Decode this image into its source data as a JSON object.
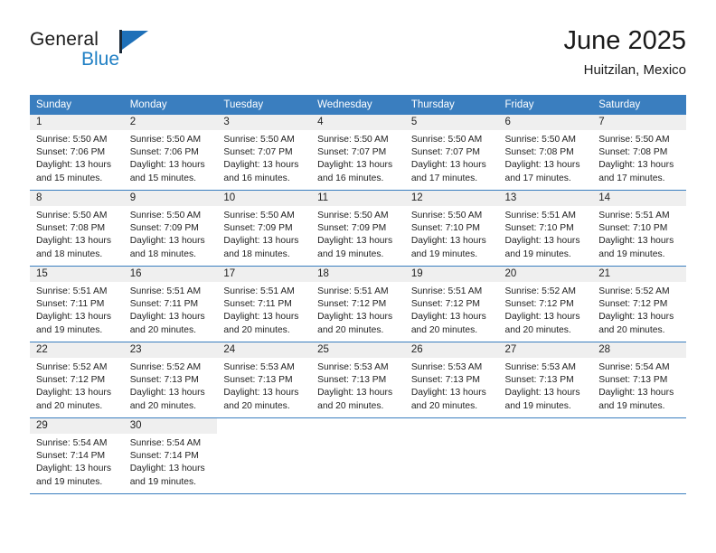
{
  "brand": {
    "name_part1": "General",
    "name_part2": "Blue",
    "flag_icon": "flag-icon",
    "accent_color": "#1e70b8"
  },
  "header": {
    "title": "June 2025",
    "location": "Huitzilan, Mexico"
  },
  "theme": {
    "header_blue": "#3a7ebf",
    "daynum_bg": "#efefef",
    "text": "#222222"
  },
  "columns": [
    "Sunday",
    "Monday",
    "Tuesday",
    "Wednesday",
    "Thursday",
    "Friday",
    "Saturday"
  ],
  "weeks": [
    [
      {
        "day": "1",
        "sunrise": "Sunrise: 5:50 AM",
        "sunset": "Sunset: 7:06 PM",
        "daylight1": "Daylight: 13 hours",
        "daylight2": "and 15 minutes."
      },
      {
        "day": "2",
        "sunrise": "Sunrise: 5:50 AM",
        "sunset": "Sunset: 7:06 PM",
        "daylight1": "Daylight: 13 hours",
        "daylight2": "and 15 minutes."
      },
      {
        "day": "3",
        "sunrise": "Sunrise: 5:50 AM",
        "sunset": "Sunset: 7:07 PM",
        "daylight1": "Daylight: 13 hours",
        "daylight2": "and 16 minutes."
      },
      {
        "day": "4",
        "sunrise": "Sunrise: 5:50 AM",
        "sunset": "Sunset: 7:07 PM",
        "daylight1": "Daylight: 13 hours",
        "daylight2": "and 16 minutes."
      },
      {
        "day": "5",
        "sunrise": "Sunrise: 5:50 AM",
        "sunset": "Sunset: 7:07 PM",
        "daylight1": "Daylight: 13 hours",
        "daylight2": "and 17 minutes."
      },
      {
        "day": "6",
        "sunrise": "Sunrise: 5:50 AM",
        "sunset": "Sunset: 7:08 PM",
        "daylight1": "Daylight: 13 hours",
        "daylight2": "and 17 minutes."
      },
      {
        "day": "7",
        "sunrise": "Sunrise: 5:50 AM",
        "sunset": "Sunset: 7:08 PM",
        "daylight1": "Daylight: 13 hours",
        "daylight2": "and 17 minutes."
      }
    ],
    [
      {
        "day": "8",
        "sunrise": "Sunrise: 5:50 AM",
        "sunset": "Sunset: 7:08 PM",
        "daylight1": "Daylight: 13 hours",
        "daylight2": "and 18 minutes."
      },
      {
        "day": "9",
        "sunrise": "Sunrise: 5:50 AM",
        "sunset": "Sunset: 7:09 PM",
        "daylight1": "Daylight: 13 hours",
        "daylight2": "and 18 minutes."
      },
      {
        "day": "10",
        "sunrise": "Sunrise: 5:50 AM",
        "sunset": "Sunset: 7:09 PM",
        "daylight1": "Daylight: 13 hours",
        "daylight2": "and 18 minutes."
      },
      {
        "day": "11",
        "sunrise": "Sunrise: 5:50 AM",
        "sunset": "Sunset: 7:09 PM",
        "daylight1": "Daylight: 13 hours",
        "daylight2": "and 19 minutes."
      },
      {
        "day": "12",
        "sunrise": "Sunrise: 5:50 AM",
        "sunset": "Sunset: 7:10 PM",
        "daylight1": "Daylight: 13 hours",
        "daylight2": "and 19 minutes."
      },
      {
        "day": "13",
        "sunrise": "Sunrise: 5:51 AM",
        "sunset": "Sunset: 7:10 PM",
        "daylight1": "Daylight: 13 hours",
        "daylight2": "and 19 minutes."
      },
      {
        "day": "14",
        "sunrise": "Sunrise: 5:51 AM",
        "sunset": "Sunset: 7:10 PM",
        "daylight1": "Daylight: 13 hours",
        "daylight2": "and 19 minutes."
      }
    ],
    [
      {
        "day": "15",
        "sunrise": "Sunrise: 5:51 AM",
        "sunset": "Sunset: 7:11 PM",
        "daylight1": "Daylight: 13 hours",
        "daylight2": "and 19 minutes."
      },
      {
        "day": "16",
        "sunrise": "Sunrise: 5:51 AM",
        "sunset": "Sunset: 7:11 PM",
        "daylight1": "Daylight: 13 hours",
        "daylight2": "and 20 minutes."
      },
      {
        "day": "17",
        "sunrise": "Sunrise: 5:51 AM",
        "sunset": "Sunset: 7:11 PM",
        "daylight1": "Daylight: 13 hours",
        "daylight2": "and 20 minutes."
      },
      {
        "day": "18",
        "sunrise": "Sunrise: 5:51 AM",
        "sunset": "Sunset: 7:12 PM",
        "daylight1": "Daylight: 13 hours",
        "daylight2": "and 20 minutes."
      },
      {
        "day": "19",
        "sunrise": "Sunrise: 5:51 AM",
        "sunset": "Sunset: 7:12 PM",
        "daylight1": "Daylight: 13 hours",
        "daylight2": "and 20 minutes."
      },
      {
        "day": "20",
        "sunrise": "Sunrise: 5:52 AM",
        "sunset": "Sunset: 7:12 PM",
        "daylight1": "Daylight: 13 hours",
        "daylight2": "and 20 minutes."
      },
      {
        "day": "21",
        "sunrise": "Sunrise: 5:52 AM",
        "sunset": "Sunset: 7:12 PM",
        "daylight1": "Daylight: 13 hours",
        "daylight2": "and 20 minutes."
      }
    ],
    [
      {
        "day": "22",
        "sunrise": "Sunrise: 5:52 AM",
        "sunset": "Sunset: 7:12 PM",
        "daylight1": "Daylight: 13 hours",
        "daylight2": "and 20 minutes."
      },
      {
        "day": "23",
        "sunrise": "Sunrise: 5:52 AM",
        "sunset": "Sunset: 7:13 PM",
        "daylight1": "Daylight: 13 hours",
        "daylight2": "and 20 minutes."
      },
      {
        "day": "24",
        "sunrise": "Sunrise: 5:53 AM",
        "sunset": "Sunset: 7:13 PM",
        "daylight1": "Daylight: 13 hours",
        "daylight2": "and 20 minutes."
      },
      {
        "day": "25",
        "sunrise": "Sunrise: 5:53 AM",
        "sunset": "Sunset: 7:13 PM",
        "daylight1": "Daylight: 13 hours",
        "daylight2": "and 20 minutes."
      },
      {
        "day": "26",
        "sunrise": "Sunrise: 5:53 AM",
        "sunset": "Sunset: 7:13 PM",
        "daylight1": "Daylight: 13 hours",
        "daylight2": "and 20 minutes."
      },
      {
        "day": "27",
        "sunrise": "Sunrise: 5:53 AM",
        "sunset": "Sunset: 7:13 PM",
        "daylight1": "Daylight: 13 hours",
        "daylight2": "and 19 minutes."
      },
      {
        "day": "28",
        "sunrise": "Sunrise: 5:54 AM",
        "sunset": "Sunset: 7:13 PM",
        "daylight1": "Daylight: 13 hours",
        "daylight2": "and 19 minutes."
      }
    ],
    [
      {
        "day": "29",
        "sunrise": "Sunrise: 5:54 AM",
        "sunset": "Sunset: 7:14 PM",
        "daylight1": "Daylight: 13 hours",
        "daylight2": "and 19 minutes."
      },
      {
        "day": "30",
        "sunrise": "Sunrise: 5:54 AM",
        "sunset": "Sunset: 7:14 PM",
        "daylight1": "Daylight: 13 hours",
        "daylight2": "and 19 minutes."
      },
      {
        "day": "",
        "sunrise": "",
        "sunset": "",
        "daylight1": "",
        "daylight2": ""
      },
      {
        "day": "",
        "sunrise": "",
        "sunset": "",
        "daylight1": "",
        "daylight2": ""
      },
      {
        "day": "",
        "sunrise": "",
        "sunset": "",
        "daylight1": "",
        "daylight2": ""
      },
      {
        "day": "",
        "sunrise": "",
        "sunset": "",
        "daylight1": "",
        "daylight2": ""
      },
      {
        "day": "",
        "sunrise": "",
        "sunset": "",
        "daylight1": "",
        "daylight2": ""
      }
    ]
  ]
}
